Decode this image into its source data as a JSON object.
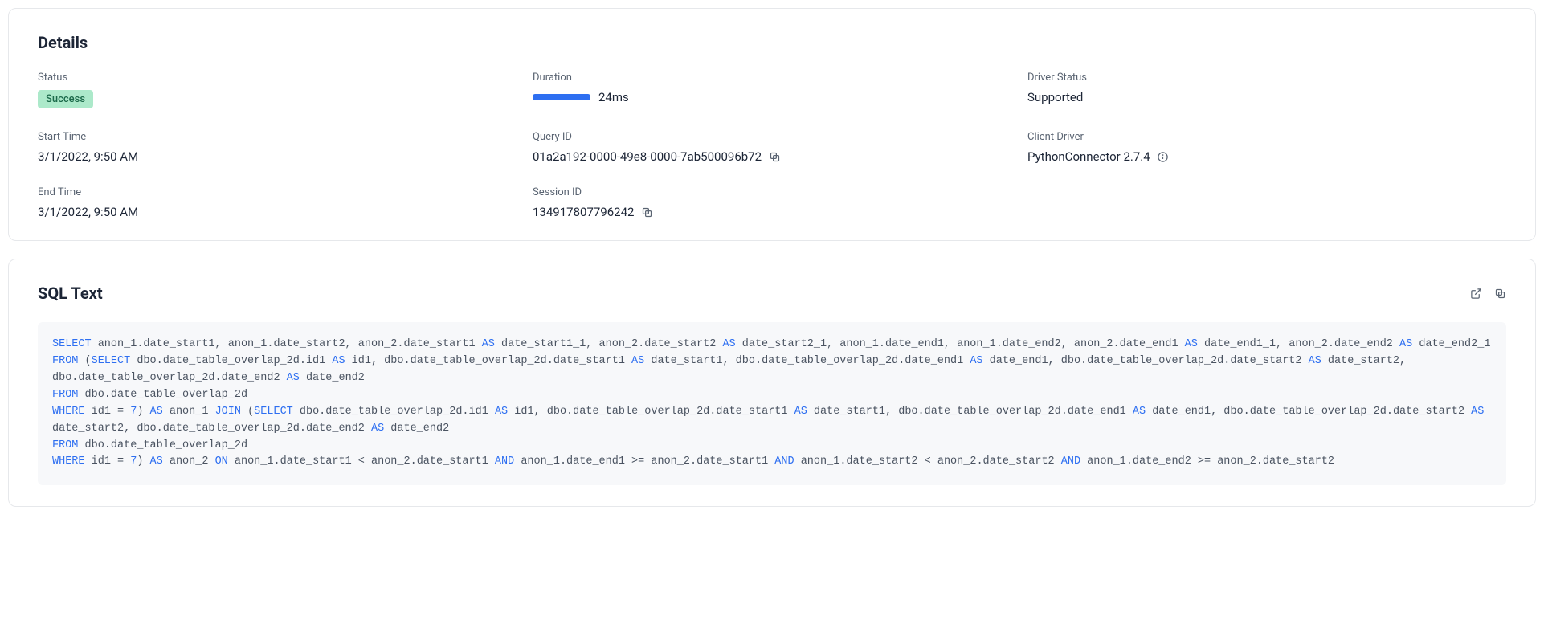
{
  "details": {
    "title": "Details",
    "status_label": "Status",
    "status_value": "Success",
    "duration_label": "Duration",
    "duration_value": "24ms",
    "driver_status_label": "Driver Status",
    "driver_status_value": "Supported",
    "start_time_label": "Start Time",
    "start_time_value": "3/1/2022, 9:50 AM",
    "query_id_label": "Query ID",
    "query_id_value": "01a2a192-0000-49e8-0000-7ab500096b72",
    "client_driver_label": "Client Driver",
    "client_driver_value": "PythonConnector 2.7.4",
    "end_time_label": "End Time",
    "end_time_value": "3/1/2022, 9:50 AM",
    "session_id_label": "Session ID",
    "session_id_value": "134917807796242"
  },
  "sql": {
    "title": "SQL Text",
    "text": "SELECT anon_1.date_start1, anon_1.date_start2, anon_2.date_start1 AS date_start1_1, anon_2.date_start2 AS date_start2_1, anon_1.date_end1, anon_1.date_end2, anon_2.date_end1 AS date_end1_1, anon_2.date_end2 AS date_end2_1\nFROM (SELECT dbo.date_table_overlap_2d.id1 AS id1, dbo.date_table_overlap_2d.date_start1 AS date_start1, dbo.date_table_overlap_2d.date_end1 AS date_end1, dbo.date_table_overlap_2d.date_start2 AS date_start2, dbo.date_table_overlap_2d.date_end2 AS date_end2\nFROM dbo.date_table_overlap_2d\nWHERE id1 = 7) AS anon_1 JOIN (SELECT dbo.date_table_overlap_2d.id1 AS id1, dbo.date_table_overlap_2d.date_start1 AS date_start1, dbo.date_table_overlap_2d.date_end1 AS date_end1, dbo.date_table_overlap_2d.date_start2 AS date_start2, dbo.date_table_overlap_2d.date_end2 AS date_end2\nFROM dbo.date_table_overlap_2d\nWHERE id1 = 7) AS anon_2 ON anon_1.date_start1 < anon_2.date_start1 AND anon_1.date_end1 >= anon_2.date_start1 AND anon_1.date_start2 < anon_2.date_start2 AND anon_1.date_end2 >= anon_2.date_start2"
  }
}
